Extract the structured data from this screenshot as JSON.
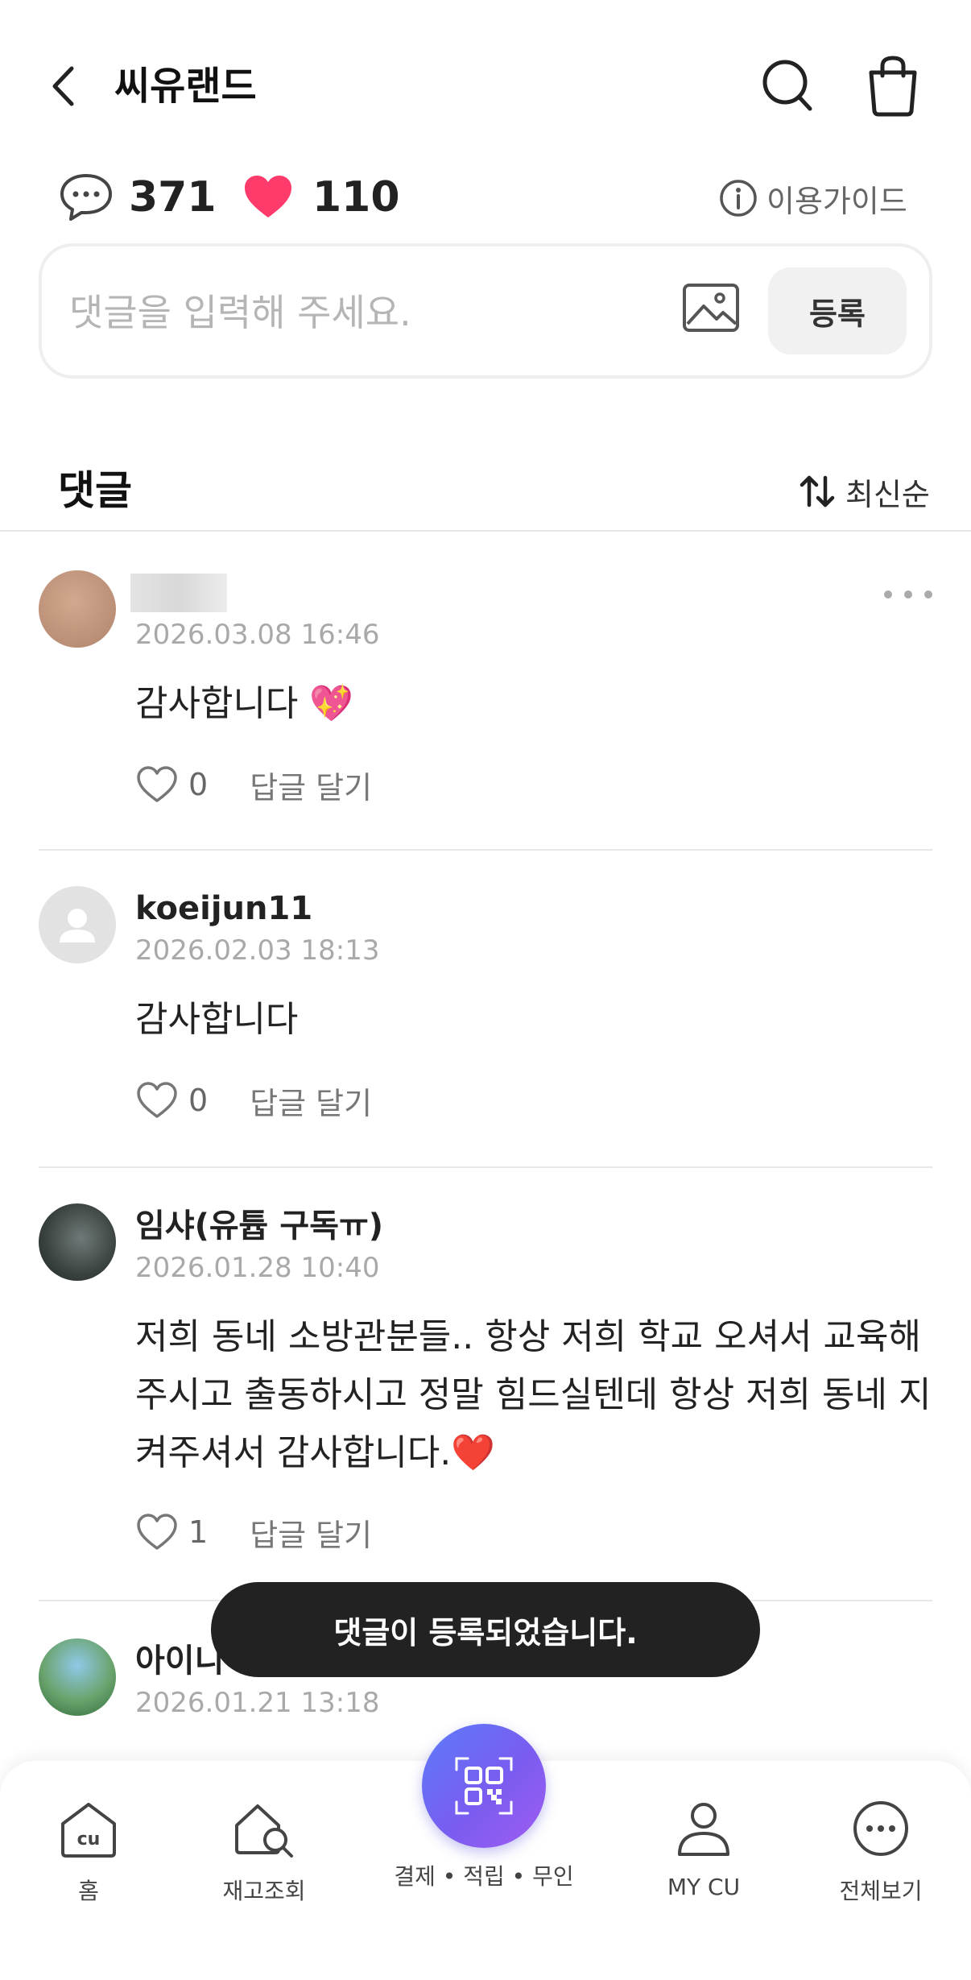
{
  "header": {
    "title": "씨유랜드"
  },
  "stats": {
    "comment_count": "371",
    "like_count": "110",
    "guide_label": "이용가이드"
  },
  "comment_input": {
    "placeholder": "댓글을 입력해 주세요.",
    "submit_label": "등록"
  },
  "comments_section": {
    "title": "댓글",
    "sort_label": "최신순"
  },
  "comments": [
    {
      "author": "",
      "date": "2026.03.08 16:46",
      "text": "감사합니다 💖",
      "likes": "0",
      "reply_label": "답글 달기"
    },
    {
      "author": "koeijun11",
      "date": "2026.02.03 18:13",
      "text": "감사합니다",
      "likes": "0",
      "reply_label": "답글 달기"
    },
    {
      "author": "임샤(유튭 구독ㅠ)",
      "date": "2026.01.28 10:40",
      "text": "저희 동네 소방관분들.. 항상 저희 학교 오셔서 교육해주시고 출동하시고 정말 힘드실텐데 항상 저희 동네 지켜주셔서 감사합니다.❤️",
      "likes": "1",
      "reply_label": "답글 달기"
    },
    {
      "author": "아이니",
      "date": "2026.01.21 13:18"
    }
  ],
  "toast": {
    "message": "댓글이 등록되었습니다."
  },
  "bottom_nav": {
    "home": "홈",
    "stock": "재고조회",
    "pay": "결제 • 적립 • 무인",
    "my": "MY CU",
    "all": "전체보기"
  },
  "colors": {
    "heart_accent": "#ff3b6b",
    "pay_gradient_start": "#5b7cfa",
    "pay_gradient_end": "#a15cf2",
    "toast_bg": "#222222"
  },
  "icons": [
    "back-arrow-icon",
    "search-icon",
    "shopping-bag-icon",
    "speech-bubble-icon",
    "heart-icon",
    "info-icon",
    "image-icon",
    "sort-arrows-icon",
    "more-icon",
    "heart-outline-icon",
    "cu-home-icon",
    "stock-search-icon",
    "qr-code-icon",
    "person-icon",
    "more-circle-icon"
  ]
}
